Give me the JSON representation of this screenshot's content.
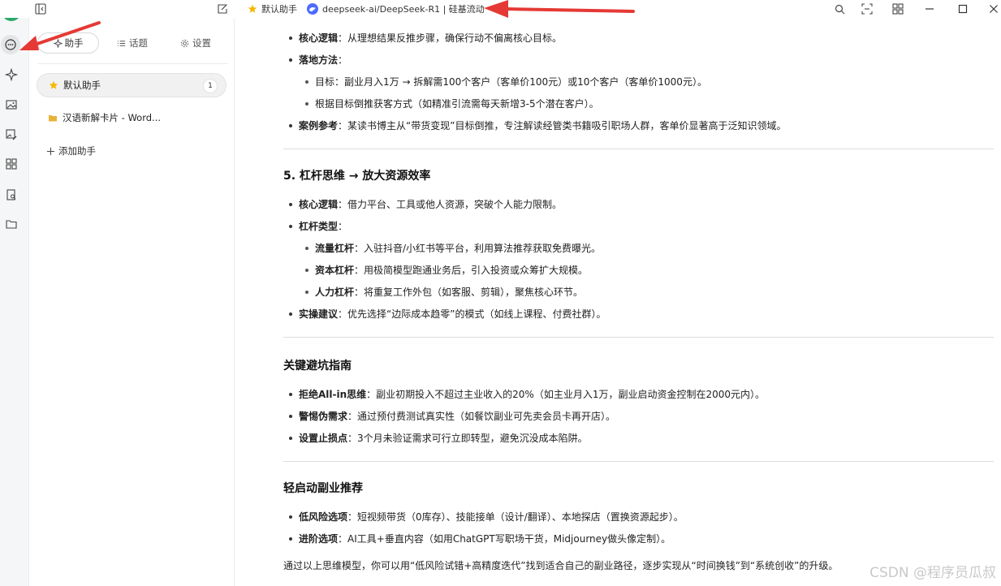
{
  "topbar": {
    "assistant_name": "默认助手",
    "model_name": "deepseek-ai/DeepSeek-R1 | 硅基流动"
  },
  "sidebar": {
    "tabs": [
      "助手",
      "话题",
      "设置"
    ],
    "assistants": [
      {
        "name": "默认助手",
        "count": "1",
        "icon": "star-icon"
      },
      {
        "name": "汉语新解卡片 - Word...",
        "icon": "folder-icon"
      }
    ],
    "add_label": "添加助手"
  },
  "content": {
    "section4_bullets": [
      {
        "bold": "核心逻辑",
        "text": "：从理想结果反推步骤，确保行动不偏离核心目标。"
      },
      {
        "bold": "落地方法",
        "text": "："
      },
      {
        "bold": "",
        "text": "目标：副业月入1万 → 拆解需100个客户（客单价100元）或10个客户（客单价1000元）。"
      },
      {
        "bold": "",
        "text": "根据目标倒推获客方式（如精准引流需每天新增3-5个潜在客户）。"
      },
      {
        "bold": "案例参考",
        "text": "：某读书博主从“带货变现”目标倒推，专注解读经管类书籍吸引职场人群，客单价显著高于泛知识领域。"
      }
    ],
    "section5_title": "5. 杠杆思维 → 放大资源效率",
    "section5_bullets": [
      {
        "bold": "核心逻辑",
        "text": "：借力平台、工具或他人资源，突破个人能力限制。"
      },
      {
        "bold": "杠杆类型",
        "text": "："
      },
      {
        "bold": "流量杠杆",
        "text": "：入驻抖音/小红书等平台，利用算法推荐获取免费曝光。"
      },
      {
        "bold": "资本杠杆",
        "text": "：用极简模型跑通业务后，引入投资或众筹扩大规模。"
      },
      {
        "bold": "人力杠杆",
        "text": "：将重复工作外包（如客服、剪辑），聚焦核心环节。"
      },
      {
        "bold": "实操建议",
        "text": "：优先选择“边际成本趋零”的模式（如线上课程、付费社群）。"
      }
    ],
    "pitfalls_title": "关键避坑指南",
    "pitfalls_bullets": [
      {
        "bold": "拒绝All-in思维",
        "text": "：副业初期投入不超过主业收入的20%（如主业月入1万，副业启动资金控制在2000元内）。"
      },
      {
        "bold": "警惕伪需求",
        "text": "：通过预付费测试真实性（如餐饮副业可先卖会员卡再开店）。"
      },
      {
        "bold": "设置止损点",
        "text": "：3个月未验证需求可行立即转型，避免沉没成本陷阱。"
      }
    ],
    "light_title": "轻启动副业推荐",
    "light_bullets": [
      {
        "bold": "低风险选项",
        "text": "：短视频带货（0库存）、技能接单（设计/翻译）、本地探店（置换资源起步）。"
      },
      {
        "bold": "进阶选项",
        "text": "：AI工具+垂直内容（如用ChatGPT写职场干货，Midjourney做头像定制）。"
      }
    ],
    "closing": "通过以上思维模型，你可以用“低风险试错+高精度迭代”找到适合自己的副业路径，逐步实现从“时间换钱”到“系统创收”的升级。"
  },
  "watermark": "CSDN @程序员瓜叔",
  "colors": {
    "accent_green": "#2aa86b",
    "arrow_red": "#e53935",
    "star_yellow": "#f5b800"
  }
}
